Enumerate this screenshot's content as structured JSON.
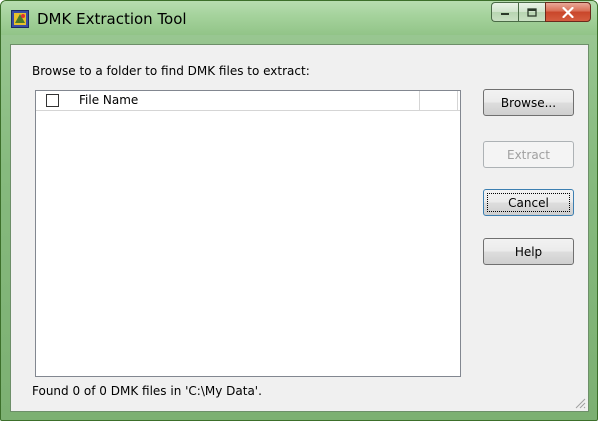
{
  "window": {
    "title": "DMK Extraction Tool",
    "caption_buttons": {
      "minimize": "minimize-icon",
      "maximize": "maximize-icon",
      "close": "close-icon"
    }
  },
  "main": {
    "instructions": "Browse to a folder to find DMK files to extract:",
    "list": {
      "columns": [
        "File Name",
        ""
      ],
      "select_all_checked": false,
      "rows": []
    },
    "status": "Found 0 of 0 DMK files in 'C:\\My Data'."
  },
  "buttons": {
    "browse": "Browse...",
    "extract": "Extract",
    "cancel": "Cancel",
    "help": "Help"
  },
  "colors": {
    "frame": "#86ba7e",
    "close": "#c9462a",
    "client": "#f0f0f0"
  }
}
